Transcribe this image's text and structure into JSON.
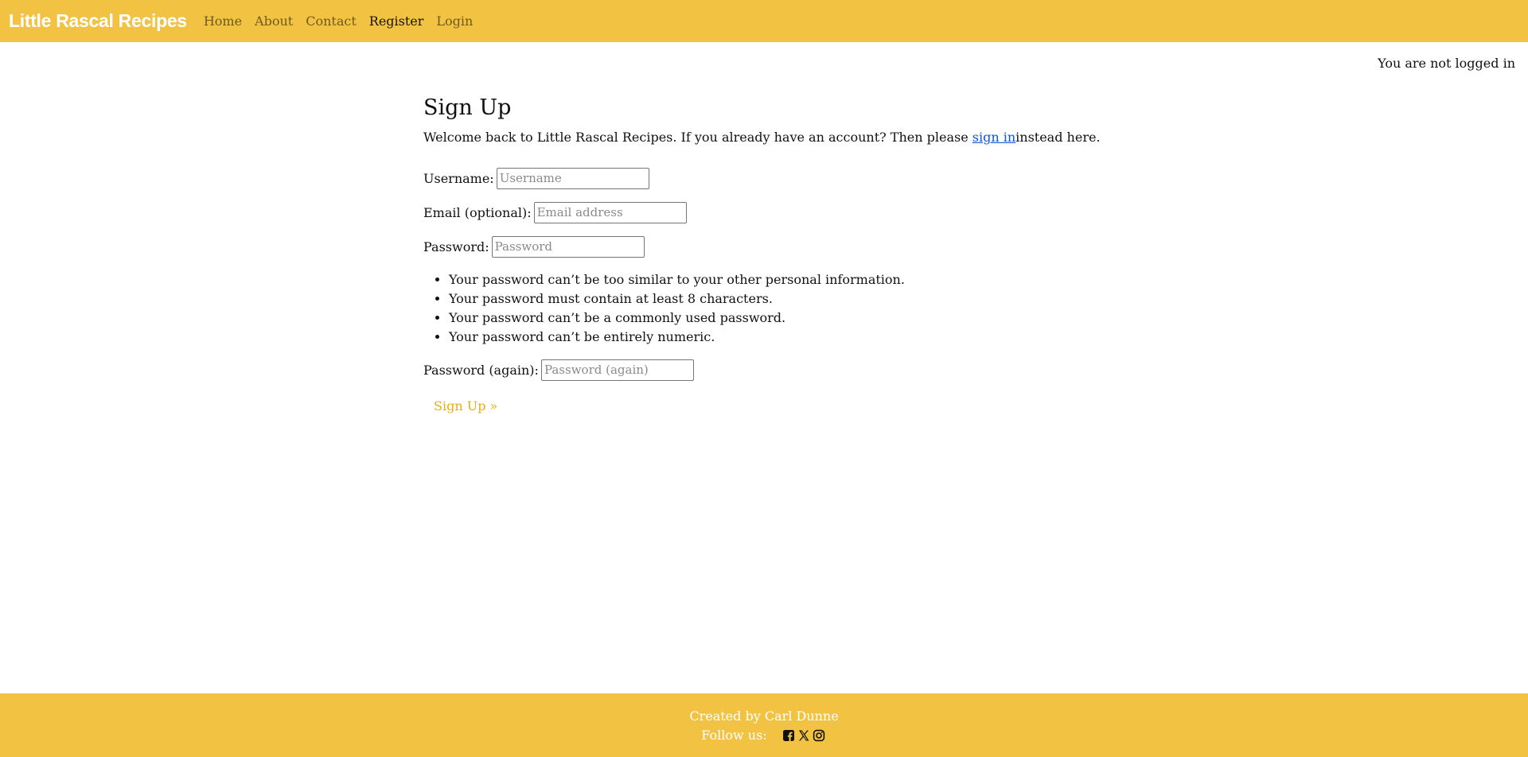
{
  "navbar": {
    "brand": "Little Rascal Recipes",
    "links": [
      {
        "label": "Home"
      },
      {
        "label": "About"
      },
      {
        "label": "Contact"
      },
      {
        "label": "Register"
      },
      {
        "label": "Login"
      }
    ],
    "active": "Register"
  },
  "status": "You are not logged in",
  "form": {
    "title": "Sign Up",
    "intro_before": "Welcome back to Little Rascal Recipes. If you already have an account? Then please ",
    "intro_link": "sign in",
    "intro_after": "instead here.",
    "fields": [
      {
        "label": "Username:",
        "placeholder": "Username",
        "value": ""
      },
      {
        "label": "Email (optional):",
        "placeholder": "Email address",
        "value": ""
      },
      {
        "label": "Password:",
        "placeholder": "Password",
        "value": ""
      }
    ],
    "help": [
      "Your password can’t be too similar to your other personal information.",
      "Your password must contain at least 8 characters.",
      "Your password can’t be a commonly used password.",
      "Your password can’t be entirely numeric."
    ],
    "password_again": {
      "label": "Password (again):",
      "placeholder": "Password (again)",
      "value": ""
    },
    "submit_label": "Sign Up »"
  },
  "footer": {
    "credit": "Created by Carl Dunne",
    "follow_label": "Follow us:",
    "social_icons": [
      "facebook-square-icon",
      "x-twitter-icon",
      "instagram-icon"
    ]
  },
  "colors": {
    "brand_yellow": "#f2c343",
    "link_blue": "#0d55d8",
    "submit_gold": "#e8ad10"
  }
}
